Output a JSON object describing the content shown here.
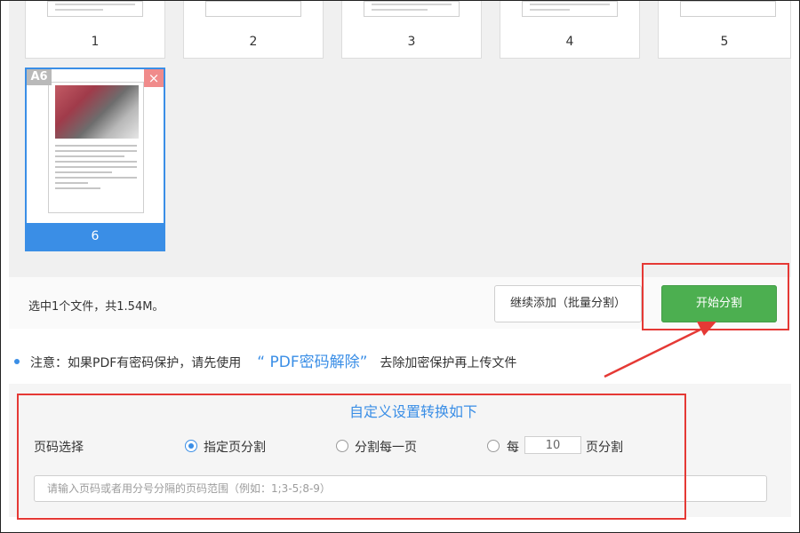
{
  "file_panel": {
    "pages": [
      {
        "number": "1"
      },
      {
        "number": "2"
      },
      {
        "number": "3"
      },
      {
        "number": "4"
      },
      {
        "number": "5"
      }
    ],
    "selected_page": {
      "badge": "A6",
      "remove_symbol": "×",
      "number": "6"
    }
  },
  "action_bar": {
    "selection_info": "选中1个文件，共1.54M。",
    "add_button": "继续添加（批量分割）",
    "start_button": "开始分割"
  },
  "note": {
    "prefix": "注意：如果PDF有密码保护，请先使用",
    "link": "“ PDF密码解除”",
    "suffix": "去除加密保护再上传文件"
  },
  "settings": {
    "title": "自定义设置转换如下",
    "row_label": "页码选择",
    "option_specified": "指定页分割",
    "option_each": "分割每一页",
    "option_every_prefix": "每",
    "option_every_value": "10",
    "option_every_suffix": "页分割",
    "selected_option": "指定页分割",
    "range_placeholder": "请输入页码或者用分号分隔的页码范围（例如：1;3-5;8-9）"
  },
  "colors": {
    "accent": "#3a8ee6",
    "start_button": "#4caf50",
    "highlight": "#e53935"
  }
}
